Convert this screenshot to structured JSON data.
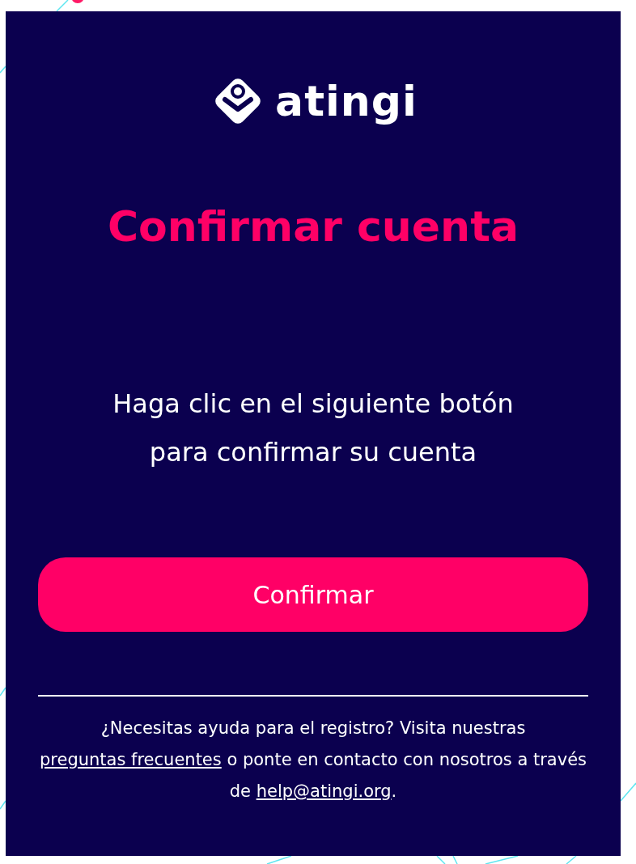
{
  "logo": {
    "wordmark": "atingi"
  },
  "title": "Confirmar cuenta",
  "message": [
    "Haga clic en el siguiente botón",
    "para confirmar su cuenta"
  ],
  "button": {
    "label": "Confirmar"
  },
  "footer": {
    "parts": [
      {
        "kind": "text",
        "text": "¿Necesitas ayuda para el registro? Visita nuestras "
      },
      {
        "kind": "link",
        "text": "preguntas frecuentes"
      },
      {
        "kind": "text",
        "text": " o ponte en contacto con nosotros a través de "
      },
      {
        "kind": "link",
        "text": "help@atingi.org"
      },
      {
        "kind": "text",
        "text": "."
      }
    ]
  }
}
